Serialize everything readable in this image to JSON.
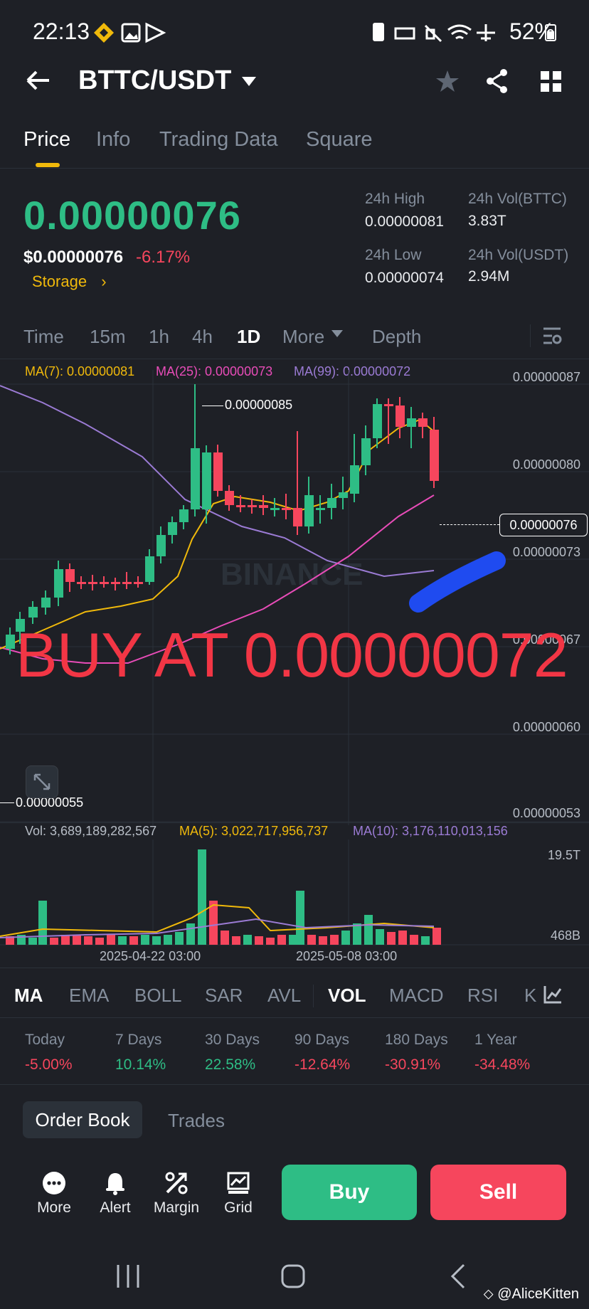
{
  "status_bar": {
    "time": "22:13",
    "battery": "52%"
  },
  "header": {
    "pair": "BTTC/USDT"
  },
  "tabs": [
    "Price",
    "Info",
    "Trading Data",
    "Square"
  ],
  "ticker": {
    "price": "0.00000076",
    "usd_price": "$0.00000076",
    "change": "-6.17%",
    "storage_label": "Storage",
    "stats": {
      "high_label": "24h High",
      "high_value": "0.00000081",
      "low_label": "24h Low",
      "low_value": "0.00000074",
      "vol_base_label": "24h Vol(BTTC)",
      "vol_base_value": "3.83T",
      "vol_quote_label": "24h Vol(USDT)",
      "vol_quote_value": "2.94M"
    }
  },
  "timeframes": [
    "Time",
    "15m",
    "1h",
    "4h",
    "1D",
    "More",
    "Depth"
  ],
  "chart": {
    "ma7": "MA(7): 0.00000081",
    "ma25": "MA(25): 0.00000073",
    "ma99": "MA(99): 0.00000072",
    "y_ticks": [
      "0.00000087",
      "0.00000080",
      "0.00000073",
      "0.00000067",
      "0.00000060",
      "0.00000053"
    ],
    "high_marker": "0.00000085",
    "low_marker": "0.00000055",
    "current_price": "0.00000076",
    "overlay_text": "BUY AT 0.00000072",
    "watermark": "BINANCE",
    "colors": {
      "up": "#2ebd85",
      "down": "#f6465d",
      "ma7": "#f0b90b",
      "ma25": "#e84cb8",
      "ma99": "#9b7bd4"
    }
  },
  "volume": {
    "vol": "Vol: 3,689,189,282,567",
    "ma5": "MA(5): 3,022,717,956,737",
    "ma10": "MA(10): 3,176,110,013,156",
    "y_ticks": [
      "19.5T",
      "468B"
    ],
    "dates": [
      "2025-04-22 03:00",
      "2025-05-08 03:00"
    ]
  },
  "indicators": [
    "MA",
    "EMA",
    "BOLL",
    "SAR",
    "AVL",
    "VOL",
    "MACD",
    "RSI",
    "K"
  ],
  "performance": [
    {
      "label": "Today",
      "value": "-5.00%"
    },
    {
      "label": "7 Days",
      "value": "10.14%"
    },
    {
      "label": "30 Days",
      "value": "22.58%"
    },
    {
      "label": "90 Days",
      "value": "-12.64%"
    },
    {
      "label": "180 Days",
      "value": "-30.91%"
    },
    {
      "label": "1 Year",
      "value": "-34.48%"
    }
  ],
  "book_tabs": {
    "order_book": "Order Book",
    "trades": "Trades"
  },
  "actions": [
    {
      "label": "More",
      "icon": "more-icon"
    },
    {
      "label": "Alert",
      "icon": "bell-icon"
    },
    {
      "label": "Margin",
      "icon": "margin-icon"
    },
    {
      "label": "Grid",
      "icon": "grid-icon"
    }
  ],
  "buttons": {
    "buy": "Buy",
    "sell": "Sell"
  },
  "credit": "@AliceKitten"
}
